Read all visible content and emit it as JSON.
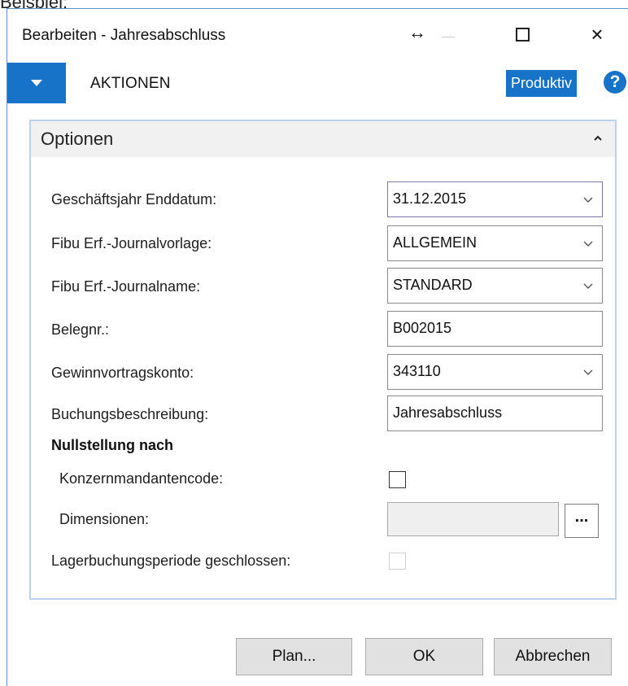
{
  "caption": "Beispiel:",
  "window": {
    "title": "Bearbeiten - Jahresabschluss",
    "resize_glyph": "↔",
    "close_glyph": "×"
  },
  "actionbar": {
    "actions_label": "AKTIONEN",
    "environment_badge": "Produktiv",
    "help_glyph": "?"
  },
  "options": {
    "title": "Optionen",
    "fields": [
      {
        "label": "Geschäftsjahr Enddatum:",
        "value": "31.12.2015",
        "dropdown": true
      },
      {
        "label": "Fibu Erf.-Journalvorlage:",
        "value": "ALLGEMEIN",
        "dropdown": true
      },
      {
        "label": "Fibu Erf.-Journalname:",
        "value": "STANDARD",
        "dropdown": true
      },
      {
        "label": "Belegnr.:",
        "value": "B002015",
        "dropdown": false
      },
      {
        "label": "Gewinnvortragskonto:",
        "value": "343110",
        "dropdown": true
      },
      {
        "label": "Buchungsbeschreibung:",
        "value": "Jahresabschluss",
        "dropdown": false
      }
    ],
    "zeroing_heading": "Nullstellung nach",
    "group_company_label": "Konzernmandantencode:",
    "group_company_checked": false,
    "dimensions_label": "Dimensionen:",
    "dimensions_value": "",
    "lookup_label": "...",
    "inventory_period_label": "Lagerbuchungsperiode geschlossen:",
    "inventory_period_checked": false
  },
  "buttons": {
    "plan": "Plan...",
    "ok": "OK",
    "cancel": "Abbrechen"
  }
}
